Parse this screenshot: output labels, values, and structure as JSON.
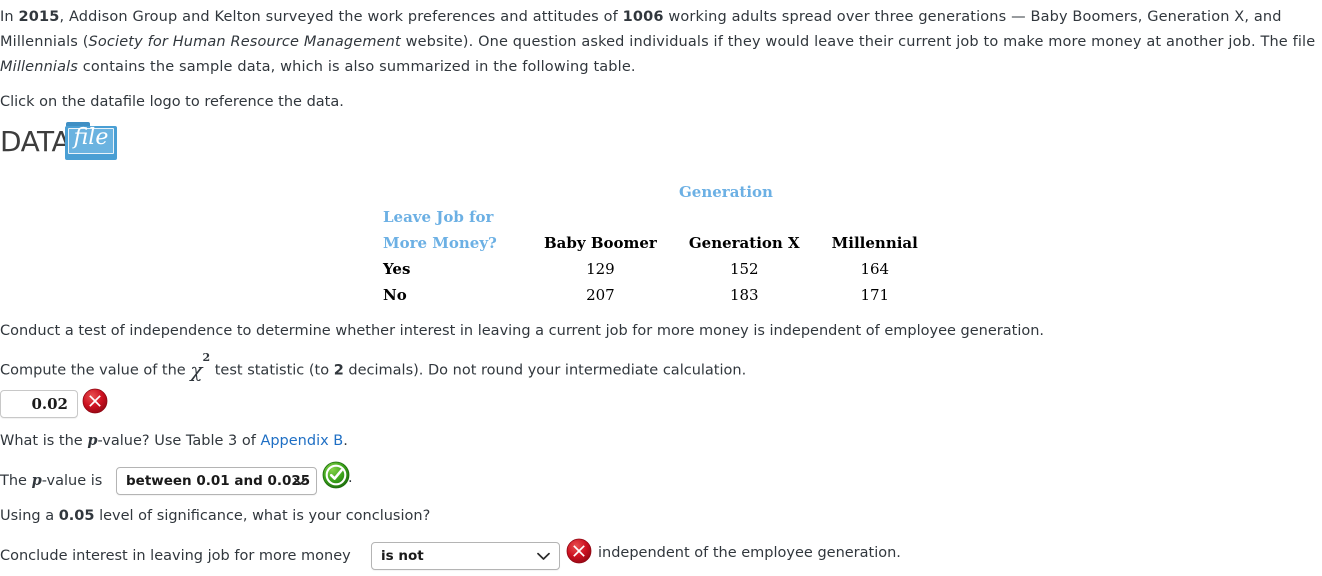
{
  "intro": {
    "seg1_prefix": "In ",
    "year": "2015",
    "seg2": ", Addison Group and Kelton surveyed the work preferences and attitudes of ",
    "sample_size": "1006",
    "seg3": " working adults spread over three generations — Baby Boomers, Generation X, and Millennials (",
    "source_italic": "Society for Human Resource Management",
    "seg4": " website). One question asked individuals if they would leave their current job to make more money at another job. The file ",
    "file_italic": "Millennials",
    "seg5": " contains the sample data, which is also summarized in the following table.",
    "click_line": "Click on the datafile logo to reference the data."
  },
  "datafile": {
    "data_word": "DATA",
    "file_word": "file",
    "folder_color": "#4a9fd4"
  },
  "table": {
    "group_header": "Generation",
    "row_header_line1": "Leave Job for",
    "row_header_line2": "More Money?",
    "accent_color": "#6cb0e4",
    "columns": [
      "Baby Boomer",
      "Generation X",
      "Millennial"
    ],
    "rows": [
      {
        "label": "Yes",
        "values": [
          "129",
          "152",
          "164"
        ]
      },
      {
        "label": "No",
        "values": [
          "207",
          "183",
          "171"
        ]
      }
    ]
  },
  "questions": {
    "conduct_test": "Conduct a test of independence to determine whether interest in leaving a current job for more money is independent of employee generation.",
    "compute_prefix": "Compute the value of the ",
    "chi_symbol": "χ",
    "chi_exponent": "2",
    "compute_mid": " test statistic (to ",
    "decimals": "2",
    "compute_suffix": " decimals). Do not round your intermediate calculation.",
    "pvalue_question_prefix": "What is the ",
    "p_symbol": "p",
    "pvalue_question_suffix": "-value? Use Table 3 of ",
    "appendix_link": "Appendix B",
    "pvalue_question_period": ".",
    "pvalue_answer_prefix": "The ",
    "pvalue_answer_suffix": "-value is ",
    "significance_prefix": "Using a ",
    "significance_level": "0.05",
    "significance_suffix": " level of significance, what is your conclusion?",
    "conclusion_prefix": "Conclude interest in leaving job for more money ",
    "conclusion_suffix": "independent of the employee generation.",
    "period": "."
  },
  "answers": {
    "chi_square_value": "0.02",
    "chi_square_status": "incorrect",
    "pvalue_selected": "between 0.01 and 0.025",
    "pvalue_status": "correct",
    "conclusion_selected": "is not",
    "conclusion_status": "incorrect"
  },
  "colors": {
    "correct_green": "#2f9e2f",
    "incorrect_red": "#c8102e",
    "link_blue": "#1f6fc4",
    "table_accent": "#6cb0e4",
    "body_text": "#31373d"
  }
}
